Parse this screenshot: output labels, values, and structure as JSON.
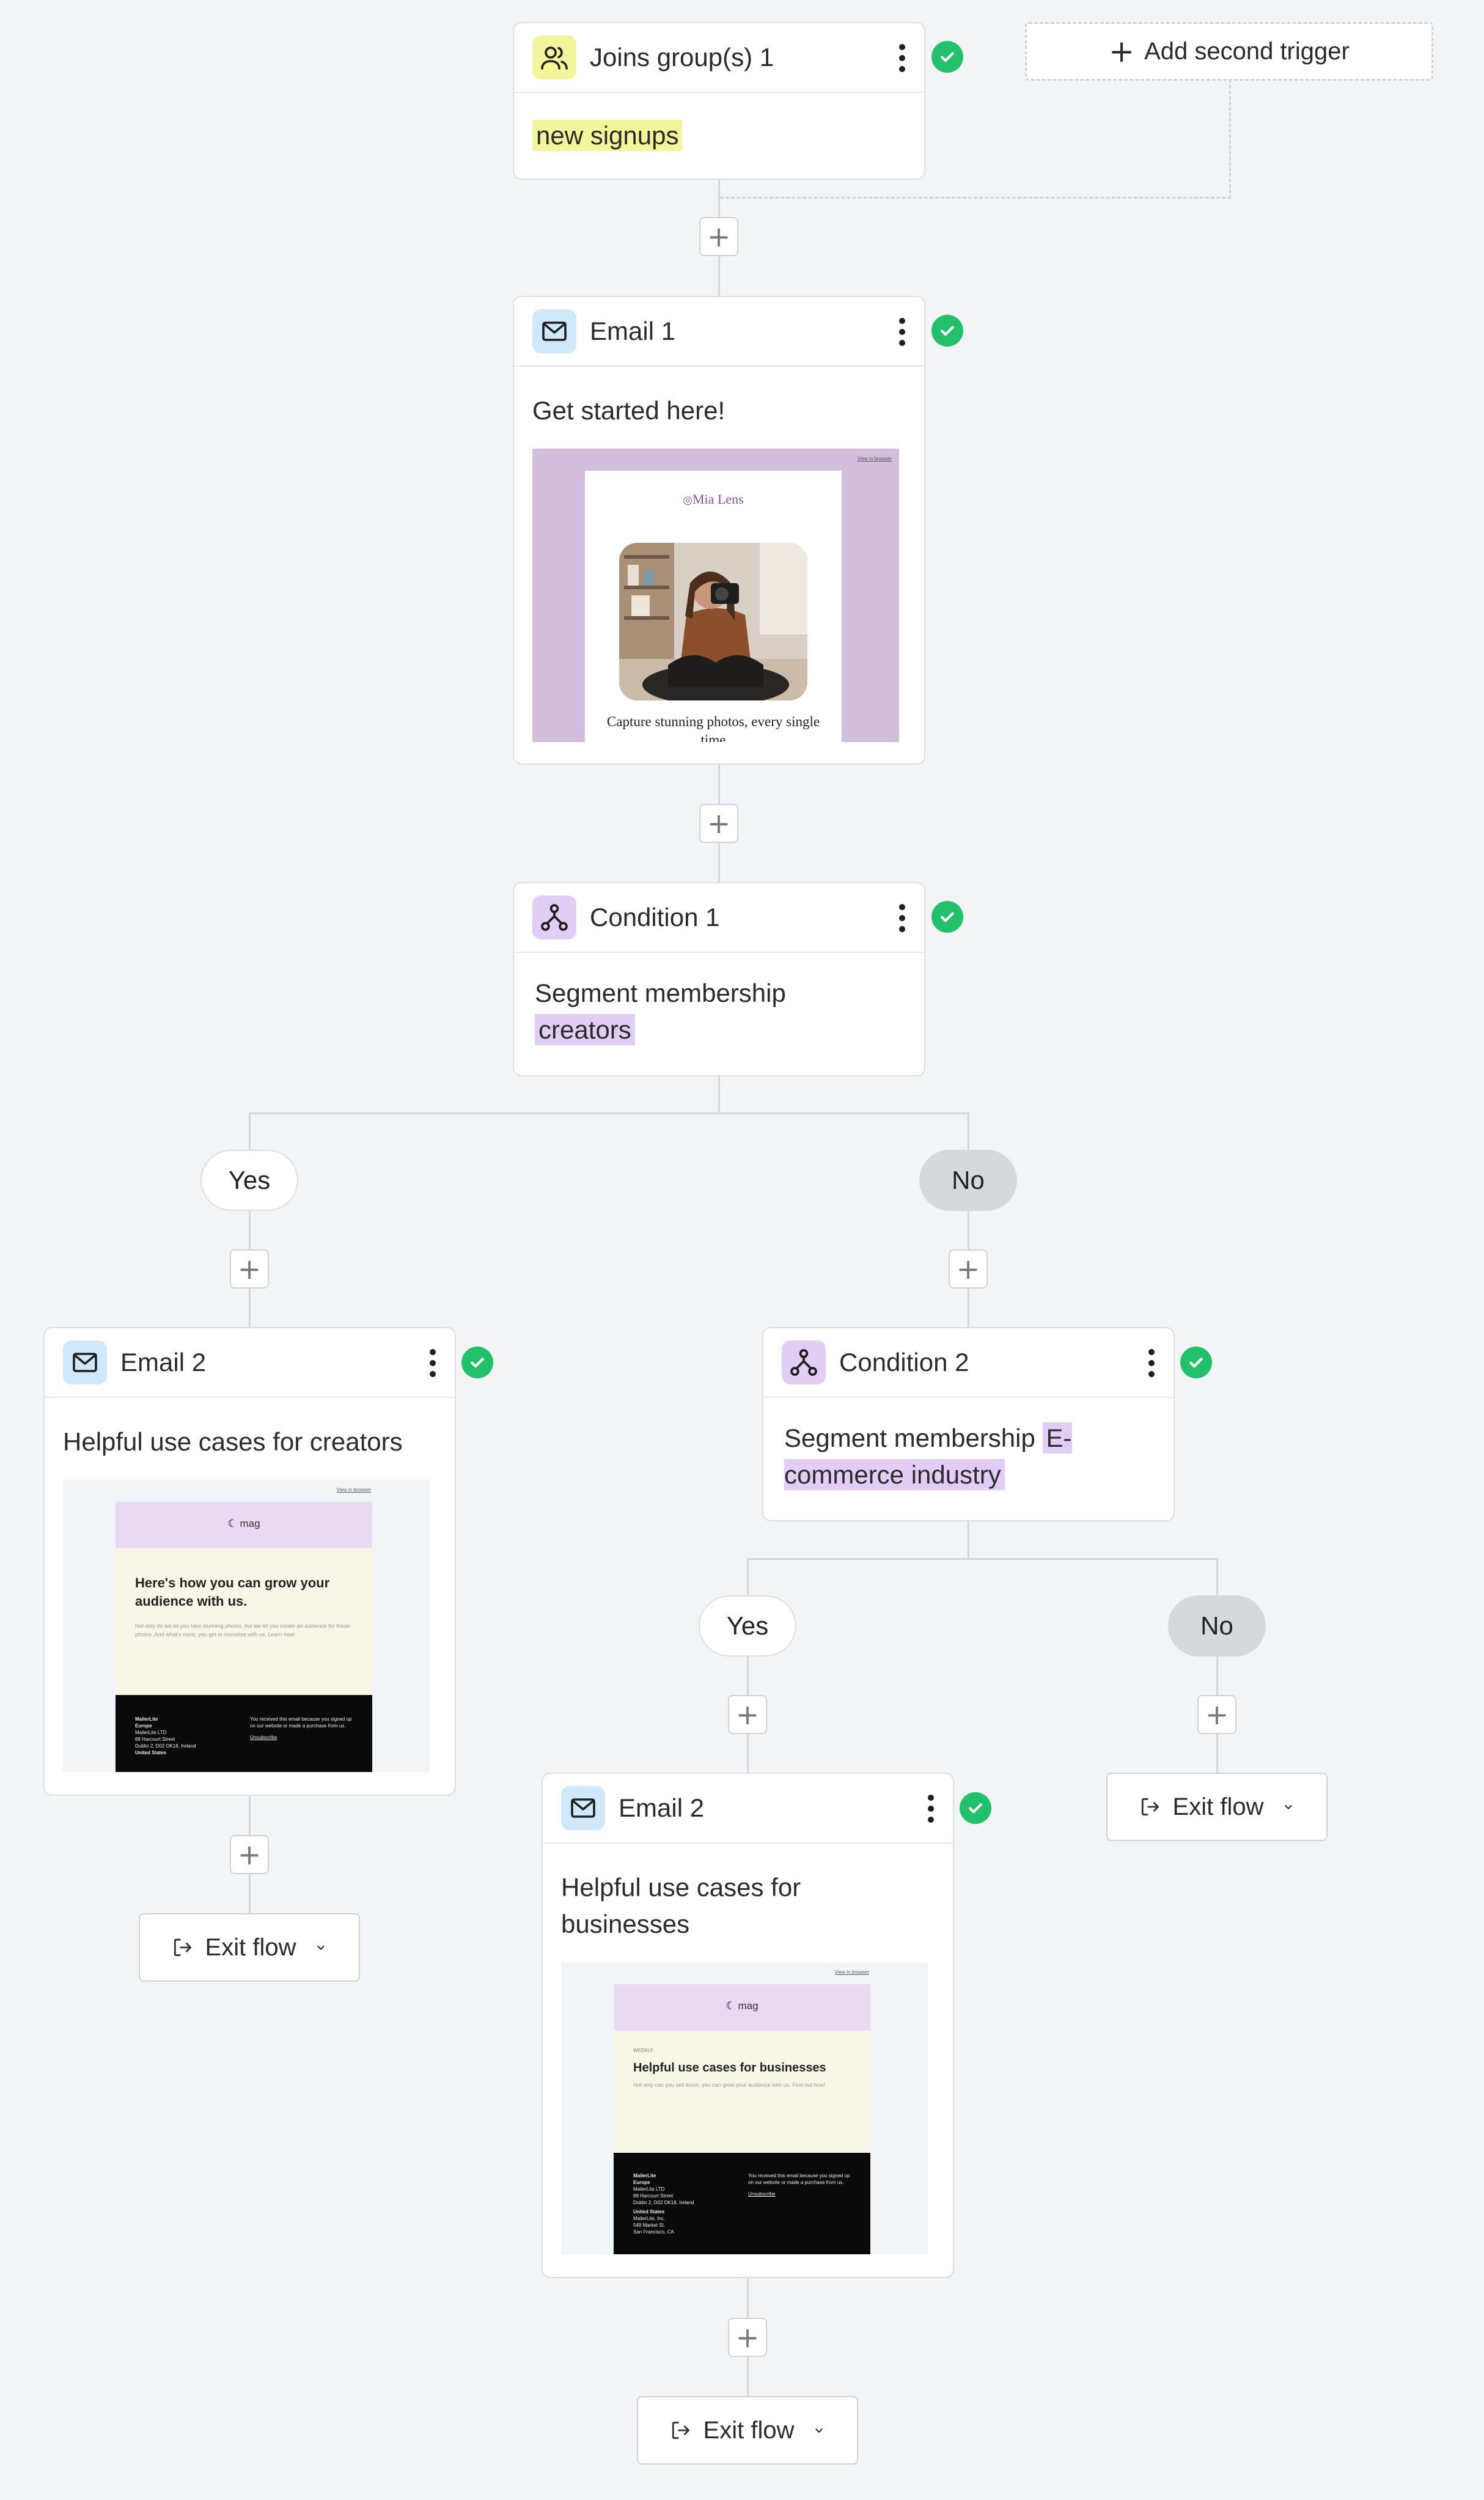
{
  "add_trigger_label": "Add second trigger",
  "nodes": {
    "trigger": {
      "title": "Joins group(s) 1",
      "value": "new signups"
    },
    "email1": {
      "title": "Email 1",
      "subject": "Get started here!",
      "preview": {
        "link": "View in browser",
        "brand": "Mia Lens",
        "caption": "Capture stunning photos, every single time"
      }
    },
    "cond1": {
      "title": "Condition 1",
      "label": "Segment membership",
      "value": "creators"
    },
    "email2a": {
      "title": "Email 2",
      "subject": "Helpful use cases for creators",
      "preview": {
        "link": "View in browser",
        "brand": "mag",
        "headline": "Here's how you can grow your audience with us.",
        "body": "Not only do we let you take stunning photos, but we let you create an audience for those photos. And what's more, you get to monetize with us. Learn how!",
        "footer_left": [
          "MailerLite",
          "Europe",
          "MailerLite LTD",
          "88 Harcourt Street",
          "Dublin 2, D02 DK18, Ireland",
          "United States"
        ],
        "footer_right": "You received this email because you signed up on our website or made a purchase from us.",
        "unsubscribe": "Unsubscribe"
      }
    },
    "cond2": {
      "title": "Condition 2",
      "label": "Segment membership",
      "value": "E-commerce industry"
    },
    "email2b": {
      "title": "Email 2",
      "subject": "Helpful use cases for businesses",
      "preview": {
        "link": "View in browser",
        "brand": "mag",
        "kicker": "WEEKLY",
        "headline": "Helpful use cases for businesses",
        "body": "Not only can you sell items, you can grow your audience with us. Find out how!",
        "footer_left": [
          "MailerLite",
          "Europe",
          "MailerLite LTD",
          "88 Harcourt Street",
          "Dublin 2, D02 DK18, Ireland",
          "United States",
          "MailerLite, Inc.",
          "548 Market St.",
          "San Francisco, CA"
        ],
        "footer_right": "You received this email because you signed up on our website or made a purchase from us.",
        "unsubscribe": "Unsubscribe"
      }
    }
  },
  "branches": {
    "yes": "Yes",
    "no": "No"
  },
  "exit_label": "Exit flow",
  "colors": {
    "background": "#f3f4f6",
    "success": "#22c06a",
    "highlight_yellow": "#f2f59a",
    "highlight_purple": "#e2cdf4",
    "connector": "#d4d6da"
  }
}
